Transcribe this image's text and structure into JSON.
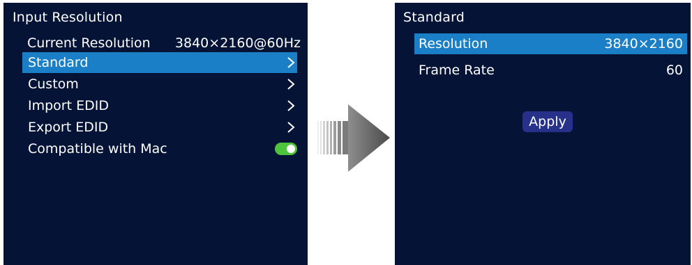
{
  "left_panel": {
    "title": "Input Resolution",
    "current_resolution": {
      "label": "Current Resolution",
      "value": "3840×2160@60Hz"
    },
    "items": [
      {
        "label": "Standard",
        "chevron": ">",
        "selected": true
      },
      {
        "label": "Custom",
        "chevron": ">"
      },
      {
        "label": "Import EDID",
        "chevron": ">"
      },
      {
        "label": "Export EDID",
        "chevron": ">"
      }
    ],
    "mac_toggle": {
      "label": "Compatible with Mac",
      "on": true,
      "color": "#4ec33b"
    }
  },
  "right_panel": {
    "title": "Standard",
    "resolution": {
      "label": "Resolution",
      "value": "3840×2160"
    },
    "frame_rate": {
      "label": "Frame Rate",
      "value": "60"
    },
    "apply_label": "Apply"
  },
  "colors": {
    "panel_bg": "#051436",
    "selected_bg": "#1b7fc7",
    "button_bg": "#27318a"
  },
  "icons": [
    "chevron-right-icon",
    "toggle-switch-icon",
    "arrow-right-icon"
  ]
}
